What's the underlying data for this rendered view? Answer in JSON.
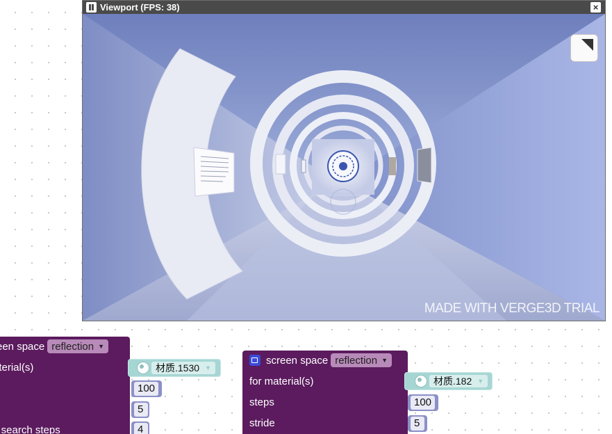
{
  "viewport": {
    "title": "Viewport (FPS: 38)",
    "close_glyph": "×",
    "watermark": "MADE WITH VERGE3D TRIAL"
  },
  "block_left": {
    "title_prefix": "reen space",
    "mode": "reflection",
    "row_material": "aterial(s)",
    "row_search": "y search steps",
    "material_value": "材质.1530",
    "steps_value": "100",
    "stride_value": "5",
    "search_value": "4"
  },
  "block_right": {
    "title_prefix": "screen space",
    "mode": "reflection",
    "row_material": "for material(s)",
    "row_steps": "steps",
    "row_stride": "stride",
    "material_value": "材质.182",
    "steps_value": "100",
    "stride_value": "5"
  },
  "colors": {
    "block_bg": "#5b1b5e",
    "material_plug": "#a6d6d4",
    "number_plug": "#8c90c6",
    "scene_ambient": "#7d8fc6"
  }
}
